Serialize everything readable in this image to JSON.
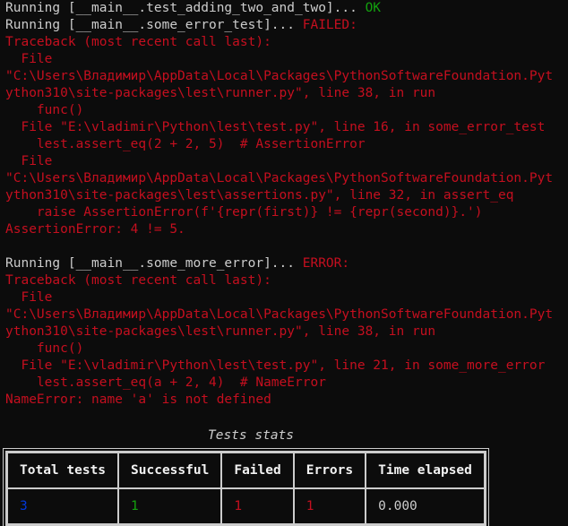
{
  "run1": {
    "running": "Running [__main__.test_adding_two_and_two]... ",
    "status": "OK"
  },
  "run2": {
    "running": "Running [__main__.some_error_test]... ",
    "status": "FAILED:",
    "traceback_header": "Traceback (most recent call last):",
    "frame1_file_kw": "  File",
    "frame1_path1": "\"C:\\Users\\Владимир\\AppData\\Local\\Packages\\PythonSoftwareFoundation.Pyt",
    "frame1_path2": "ython310\\site-packages\\lest\\runner.py\", line 38, in run",
    "frame1_code": "    func()",
    "frame2": "  File \"E:\\vladimir\\Python\\lest\\test.py\", line 16, in some_error_test",
    "frame2_code": "    lest.assert_eq(2 + 2, 5)  # AssertionError",
    "frame3_file_kw": "  File",
    "frame3_path1": "\"C:\\Users\\Владимир\\AppData\\Local\\Packages\\PythonSoftwareFoundation.Pyt",
    "frame3_path2": "ython310\\site-packages\\lest\\assertions.py\", line 32, in assert_eq",
    "frame3_code": "    raise AssertionError(f'{repr(first)} != {repr(second)}.')",
    "exception": "AssertionError: 4 != 5."
  },
  "run3": {
    "running": "Running [__main__.some_more_error]... ",
    "status": "ERROR:",
    "traceback_header": "Traceback (most recent call last):",
    "frame1_file_kw": "  File",
    "frame1_path1": "\"C:\\Users\\Владимир\\AppData\\Local\\Packages\\PythonSoftwareFoundation.Pyt",
    "frame1_path2": "ython310\\site-packages\\lest\\runner.py\", line 38, in run",
    "frame1_code": "    func()",
    "frame2": "  File \"E:\\vladimir\\Python\\lest\\test.py\", line 21, in some_more_error",
    "frame2_code": "    lest.assert_eq(a + 2, 4)  # NameError",
    "exception": "NameError: name 'a' is not defined"
  },
  "stats": {
    "title": "Tests stats",
    "headers": [
      "Total tests",
      "Successful",
      "Failed",
      "Errors",
      "Time elapsed"
    ],
    "values": [
      "3",
      "1",
      "1",
      "1",
      "0.000"
    ]
  },
  "colors": {
    "background": "#0c0c0c",
    "foreground": "#cccccc",
    "ok": "#13a10e",
    "error_red": "#c50f1f",
    "total_blue": "#0037da"
  }
}
